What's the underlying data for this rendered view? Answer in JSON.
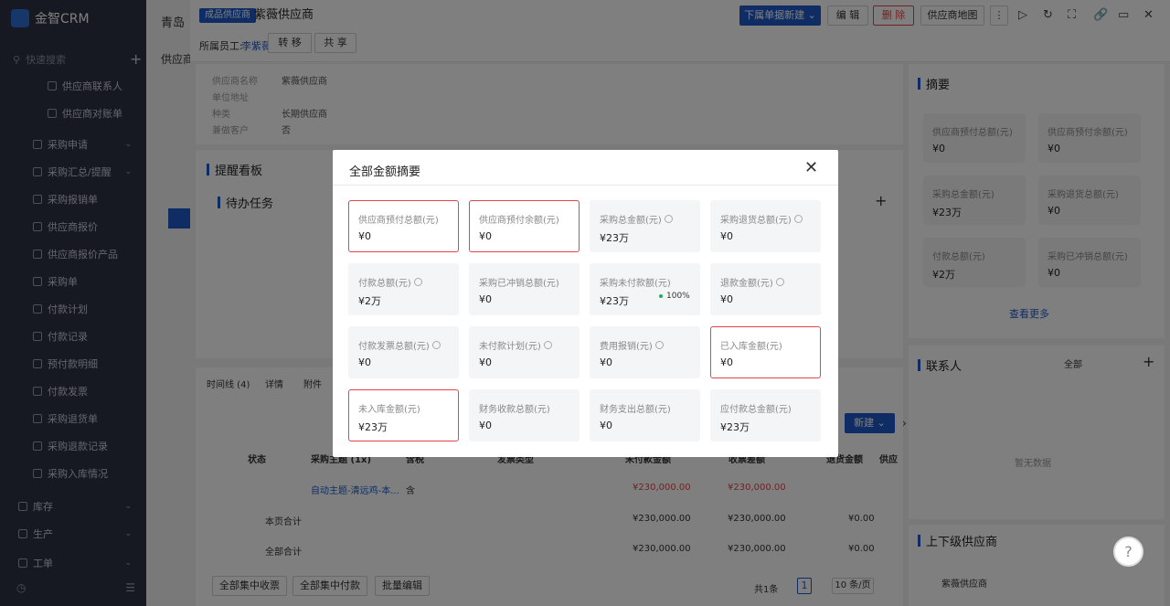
{
  "sidebar": {
    "logo": "金智CRM",
    "search_placeholder": "快速搜索",
    "items": [
      {
        "label": "供应商联系人",
        "chev": ""
      },
      {
        "label": "供应商对账单",
        "chev": ""
      },
      {
        "label": "采购申请",
        "chev": "⌄"
      },
      {
        "label": "采购汇总/提醒",
        "chev": "⌄"
      },
      {
        "label": "采购报销单",
        "chev": ""
      },
      {
        "label": "供应商报价",
        "chev": ""
      },
      {
        "label": "供应商报价产品",
        "chev": ""
      },
      {
        "label": "采购单",
        "chev": ""
      },
      {
        "label": "付款计划",
        "chev": ""
      },
      {
        "label": "付款记录",
        "chev": ""
      },
      {
        "label": "预付款明细",
        "chev": ""
      },
      {
        "label": "付款发票",
        "chev": ""
      },
      {
        "label": "采购退货单",
        "chev": ""
      },
      {
        "label": "采购退款记录",
        "chev": ""
      },
      {
        "label": "采购入库情况",
        "chev": ""
      },
      {
        "label": "库存",
        "chev": "⌄"
      },
      {
        "label": "生产",
        "chev": "⌄"
      },
      {
        "label": "工单",
        "chev": "⌄"
      }
    ]
  },
  "bg": {
    "tab": "青岛",
    "section": "供应商"
  },
  "header": {
    "tag": "成品供应商",
    "title": "紫薇供应商",
    "new_dropdown": "下属单据新建",
    "edit": "编 辑",
    "delete": "删 除",
    "map": "供应商地图",
    "owner_label": "所属员工:",
    "owner_name": "李紫薇",
    "transfer": "转 移",
    "share": "共 享"
  },
  "info": [
    {
      "label": "供应商名称",
      "value": "紫薇供应商"
    },
    {
      "label": "单位地址",
      "value": ""
    },
    {
      "label": "种类",
      "value": "长期供应商"
    },
    {
      "label": "兼做客户",
      "value": "否"
    }
  ],
  "reminder": {
    "title": "提醒看板",
    "todo": "待办任务"
  },
  "timeline": {
    "tabs": [
      "时间线 (4)",
      "详情",
      "附件"
    ],
    "new_button": "新建",
    "columns": [
      "状态",
      "采购主题 (1x)",
      "含税",
      "发票类型",
      "未付款金额",
      "收票差额",
      "退货金额",
      "供应"
    ],
    "row": {
      "subject": "自动主题-清远鸡-本...",
      "tax": "含",
      "unpaid": "¥230,000.00",
      "diff": "¥230,000.00"
    },
    "page_total": {
      "label": "本页合计",
      "unpaid": "¥230,000.00",
      "diff": "¥230,000.00",
      "refund": "¥0.00"
    },
    "all_total": {
      "label": "全部合计",
      "unpaid": "¥230,000.00",
      "diff": "¥230,000.00",
      "refund": "¥0.00"
    },
    "footer": {
      "collect": "全部集中收票",
      "pay": "全部集中付款",
      "batch": "批量编辑",
      "count": "共1条",
      "page": "1",
      "page_size": "10 条/页"
    }
  },
  "summary": {
    "title": "摘要",
    "cards": [
      {
        "label": "供应商预付总额(元)",
        "value": "¥0"
      },
      {
        "label": "供应商预付余额(元)",
        "value": "¥0"
      },
      {
        "label": "采购总金额(元)",
        "value": "¥23万"
      },
      {
        "label": "采购退货总额(元)",
        "value": "¥0"
      },
      {
        "label": "付款总额(元)",
        "value": "¥2万"
      },
      {
        "label": "采购已冲销总额(元)",
        "value": "¥0"
      }
    ],
    "more": "查看更多"
  },
  "contacts": {
    "title": "联系人",
    "filter": "全部",
    "empty": "暂无数据"
  },
  "parent": {
    "title": "上下级供应商",
    "item": "紫薇供应商"
  },
  "modal": {
    "title": "全部金额摘要",
    "cards": [
      {
        "label": "供应商预付总额(元)",
        "value": "¥0",
        "clock": false,
        "highlight": true
      },
      {
        "label": "供应商预付余额(元)",
        "value": "¥0",
        "clock": false,
        "highlight": true
      },
      {
        "label": "采购总金额(元)",
        "value": "¥23万",
        "clock": true,
        "highlight": false
      },
      {
        "label": "采购退货总额(元)",
        "value": "¥0",
        "clock": true,
        "highlight": false
      },
      {
        "label": "付款总额(元)",
        "value": "¥2万",
        "clock": true,
        "highlight": false
      },
      {
        "label": "采购已冲销总额(元)",
        "value": "¥0",
        "clock": false,
        "highlight": false
      },
      {
        "label": "采购未付款额(元)",
        "value": "¥23万",
        "clock": false,
        "highlight": false,
        "percent": "100%"
      },
      {
        "label": "退款金额(元)",
        "value": "¥0",
        "clock": true,
        "highlight": false
      },
      {
        "label": "付款发票总额(元)",
        "value": "¥0",
        "clock": true,
        "highlight": false
      },
      {
        "label": "未付款计划(元)",
        "value": "¥0",
        "clock": true,
        "highlight": false
      },
      {
        "label": "费用报销(元)",
        "value": "¥0",
        "clock": true,
        "highlight": false
      },
      {
        "label": "已入库金额(元)",
        "value": "¥0",
        "clock": false,
        "highlight": true
      },
      {
        "label": "未入库金额(元)",
        "value": "¥23万",
        "clock": false,
        "highlight": true
      },
      {
        "label": "财务收款总额(元)",
        "value": "¥0",
        "clock": false,
        "highlight": false
      },
      {
        "label": "财务支出总额(元)",
        "value": "¥0",
        "clock": false,
        "highlight": false
      },
      {
        "label": "应付款总金额(元)",
        "value": "¥23万",
        "clock": false,
        "highlight": false
      }
    ]
  }
}
